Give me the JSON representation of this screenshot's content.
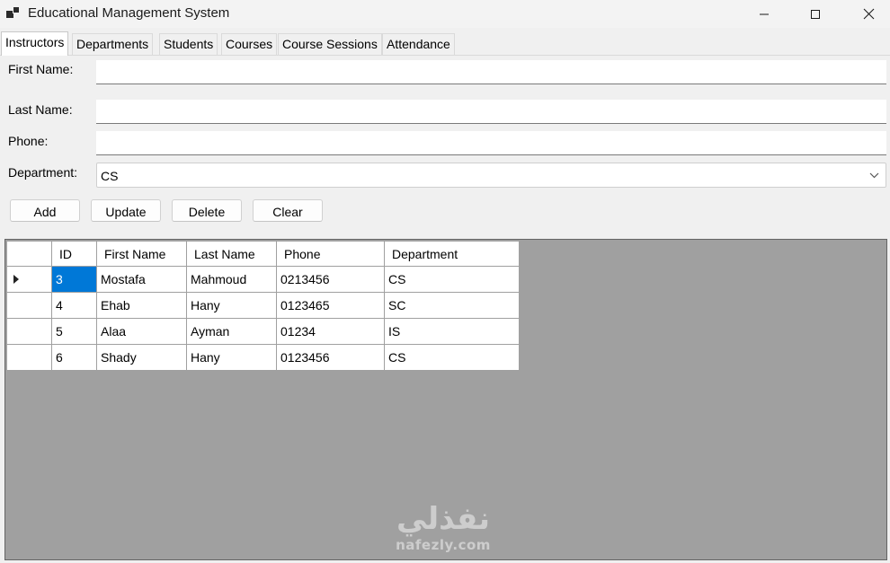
{
  "window": {
    "title": "Educational Management System"
  },
  "tabs": [
    {
      "label": "Instructors",
      "active": true
    },
    {
      "label": "Departments",
      "active": false
    },
    {
      "label": "Students",
      "active": false
    },
    {
      "label": "Courses",
      "active": false
    },
    {
      "label": "Course Sessions",
      "active": false
    },
    {
      "label": "Attendance",
      "active": false
    }
  ],
  "form": {
    "first_name_label": "First Name:",
    "first_name_value": "",
    "last_name_label": "Last Name:",
    "last_name_value": "",
    "phone_label": "Phone:",
    "phone_value": "",
    "department_label": "Department:",
    "department_value": "CS"
  },
  "buttons": {
    "add": "Add",
    "update": "Update",
    "delete": "Delete",
    "clear": "Clear"
  },
  "grid": {
    "columns": [
      "ID",
      "First Name",
      "Last Name",
      "Phone",
      "Department"
    ],
    "rows": [
      [
        "3",
        "Mostafa",
        "Mahmoud",
        "0213456",
        "CS"
      ],
      [
        "4",
        "Ehab",
        "Hany",
        "0123465",
        "SC"
      ],
      [
        "5",
        "Alaa",
        "Ayman",
        "01234",
        "IS"
      ],
      [
        "6",
        "Shady",
        "Hany",
        "0123456",
        "CS"
      ]
    ]
  },
  "watermark": {
    "logo": "نفذلي",
    "url": "nafezly.com"
  }
}
